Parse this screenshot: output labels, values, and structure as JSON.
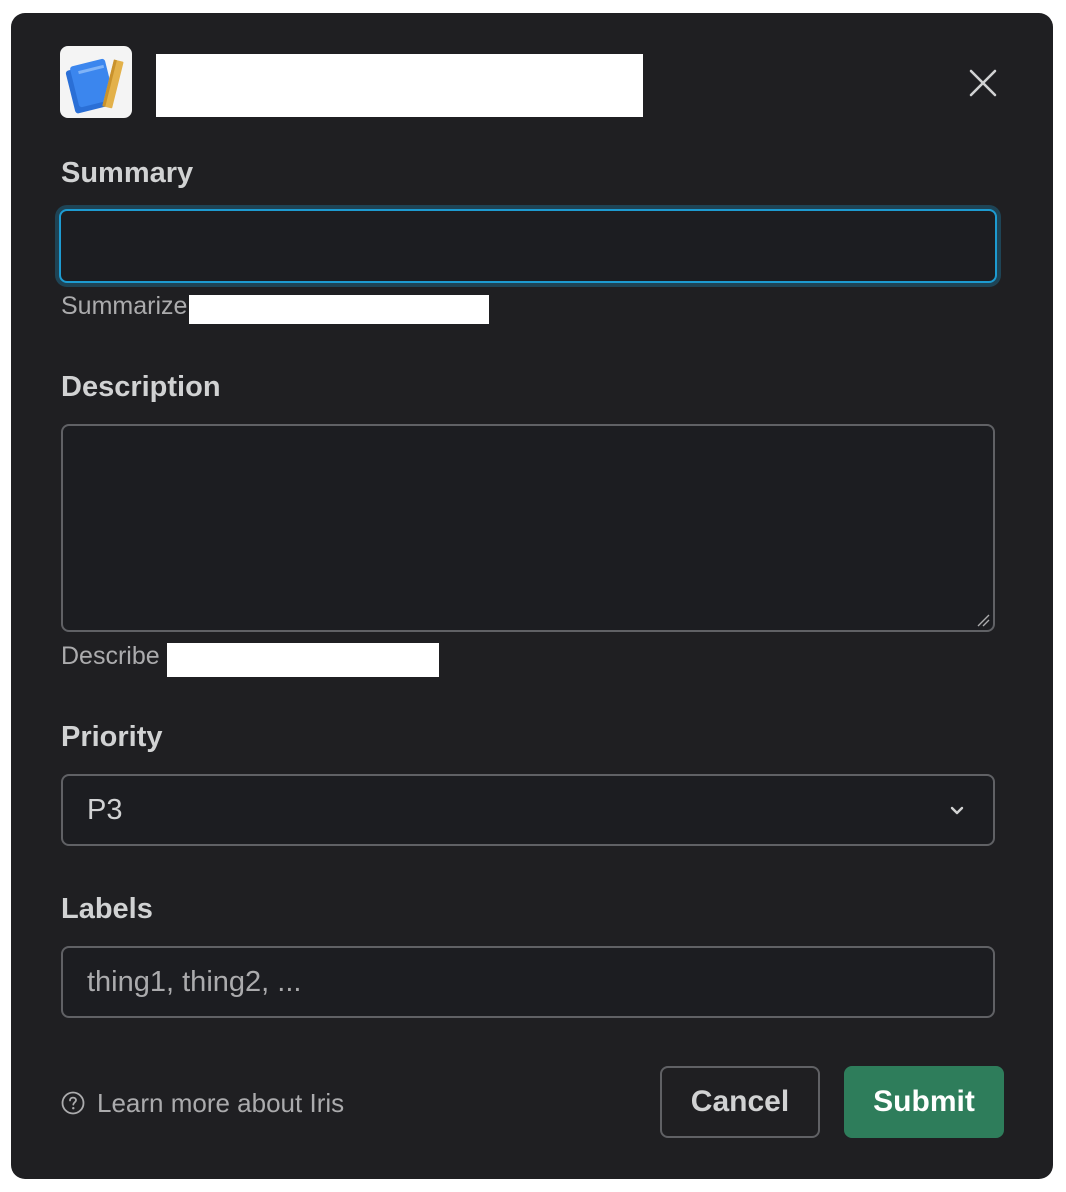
{
  "modal": {
    "close_icon": "close-icon",
    "app_icon": "notebook-ruler-icon"
  },
  "summary": {
    "label": "Summary",
    "value": "",
    "help_prefix": "Summarize"
  },
  "description": {
    "label": "Description",
    "value": "",
    "help_prefix": "Describe"
  },
  "priority": {
    "label": "Priority",
    "selected": "P3"
  },
  "labels": {
    "label": "Labels",
    "placeholder": "thing1, thing2, ..."
  },
  "footer": {
    "learn_more": "Learn more about Iris",
    "cancel_label": "Cancel",
    "submit_label": "Submit"
  },
  "colors": {
    "modal_bg": "#1f1f22",
    "focus_ring": "#1d9bd1",
    "submit_bg": "#2e7d5b"
  }
}
